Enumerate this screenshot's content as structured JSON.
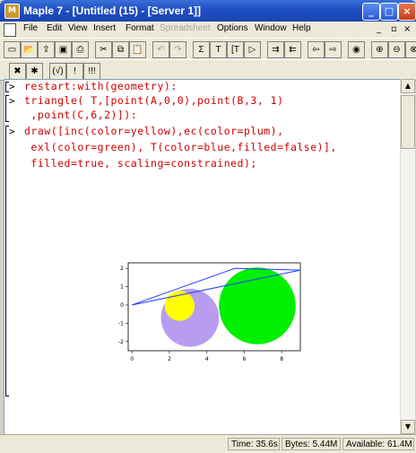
{
  "window": {
    "title": "Maple 7 - [Untitled (15) - [Server 1]]",
    "app_icon": "maple-leaf-icon"
  },
  "title_buttons": {
    "minimize": "_",
    "maximize": "□",
    "close": "×"
  },
  "menu": {
    "items": [
      {
        "label": "File",
        "enabled": true
      },
      {
        "label": "Edit",
        "enabled": true
      },
      {
        "label": "View",
        "enabled": true
      },
      {
        "label": "Insert",
        "enabled": true
      },
      {
        "label": "Format",
        "enabled": true
      },
      {
        "label": "Spreadsheet",
        "enabled": false
      },
      {
        "label": "Options",
        "enabled": true
      },
      {
        "label": "Window",
        "enabled": true
      },
      {
        "label": "Help",
        "enabled": true
      }
    ],
    "mdi_minimize": "_",
    "mdi_restore": "▫",
    "mdi_close": "×"
  },
  "toolbar1": {
    "buttons": [
      {
        "name": "new-icon",
        "glyph": "▭"
      },
      {
        "name": "open-icon",
        "glyph": "📂"
      },
      {
        "name": "open-url-icon",
        "glyph": "⇪"
      },
      {
        "name": "save-icon",
        "glyph": "▣"
      },
      {
        "name": "print-icon",
        "glyph": "⎙"
      },
      {
        "name": "cut-icon",
        "glyph": "✂"
      },
      {
        "name": "copy-icon",
        "glyph": "⧉"
      },
      {
        "name": "paste-icon",
        "glyph": "📋"
      },
      {
        "name": "undo-icon",
        "glyph": "↶"
      },
      {
        "name": "redo-icon",
        "glyph": "↷"
      },
      {
        "name": "math-input-icon",
        "glyph": "Σ"
      },
      {
        "name": "text-input-icon",
        "glyph": "T"
      },
      {
        "name": "insert-text-icon",
        "glyph": "[T"
      },
      {
        "name": "execute-group-icon",
        "glyph": "▷"
      },
      {
        "name": "indent-icon",
        "glyph": "⇉"
      },
      {
        "name": "outdent-icon",
        "glyph": "⇇"
      },
      {
        "name": "back-icon",
        "glyph": "⇦"
      },
      {
        "name": "forward-icon",
        "glyph": "⇨"
      },
      {
        "name": "stop-icon",
        "glyph": "◉"
      },
      {
        "name": "zoom-in-icon",
        "glyph": "⊕"
      },
      {
        "name": "zoom-out-icon",
        "glyph": "⊖"
      },
      {
        "name": "zoom-full-icon",
        "glyph": "⊗"
      }
    ]
  },
  "toolbar2": {
    "buttons": [
      {
        "name": "stop-calc-icon",
        "glyph": "✖"
      },
      {
        "name": "debug-icon",
        "glyph": "✱"
      },
      {
        "name": "bracket-icon",
        "glyph": "(√)"
      },
      {
        "name": "exclaim-icon",
        "glyph": "!"
      },
      {
        "name": "execute-all-icon",
        "glyph": "!!!"
      }
    ]
  },
  "worksheet": {
    "lines": [
      "restart:with(geometry):",
      "triangle( T,[point(A,0,0),point(B,3, 1)",
      " ,point(C,6,2)]):",
      "draw([inc(color=yellow),ec(color=plum),",
      " exl(color=green), T(color=blue,filled=false)],",
      " filled=true, scaling=constrained);"
    ],
    "prompts": [
      ">",
      ">",
      ">"
    ]
  },
  "chart_data": {
    "type": "scatter",
    "title": "",
    "xlabel": "",
    "ylabel": "",
    "xlim": [
      -0.2,
      9.0
    ],
    "ylim": [
      -2.5,
      2.3
    ],
    "xticks": [
      "0",
      "2",
      "4",
      "6",
      "8"
    ],
    "yticks": [
      "2",
      "1",
      "0",
      "-1",
      "-2"
    ],
    "xtick_values": [
      0,
      2,
      4,
      6,
      8
    ],
    "ytick_values": [
      2,
      1,
      0,
      -1,
      -2
    ],
    "triangle": {
      "points": [
        [
          0,
          0
        ],
        [
          5.5,
          2
        ],
        [
          9,
          1.9
        ]
      ],
      "color": "#1e3cff"
    },
    "circles": [
      {
        "name": "ec",
        "cx": 3.1,
        "cy": -0.7,
        "r": 1.55,
        "color": "#b79cf0"
      },
      {
        "name": "exl",
        "cx": 6.7,
        "cy": -0.05,
        "r": 2.05,
        "color": "#00f000"
      },
      {
        "name": "inc",
        "cx": 2.55,
        "cy": -0.05,
        "r": 0.8,
        "color": "#ffff00"
      }
    ]
  },
  "status": {
    "time": "Time: 35.6s",
    "bytes": "Bytes: 5.44M",
    "available": "Available: 61.4M"
  }
}
